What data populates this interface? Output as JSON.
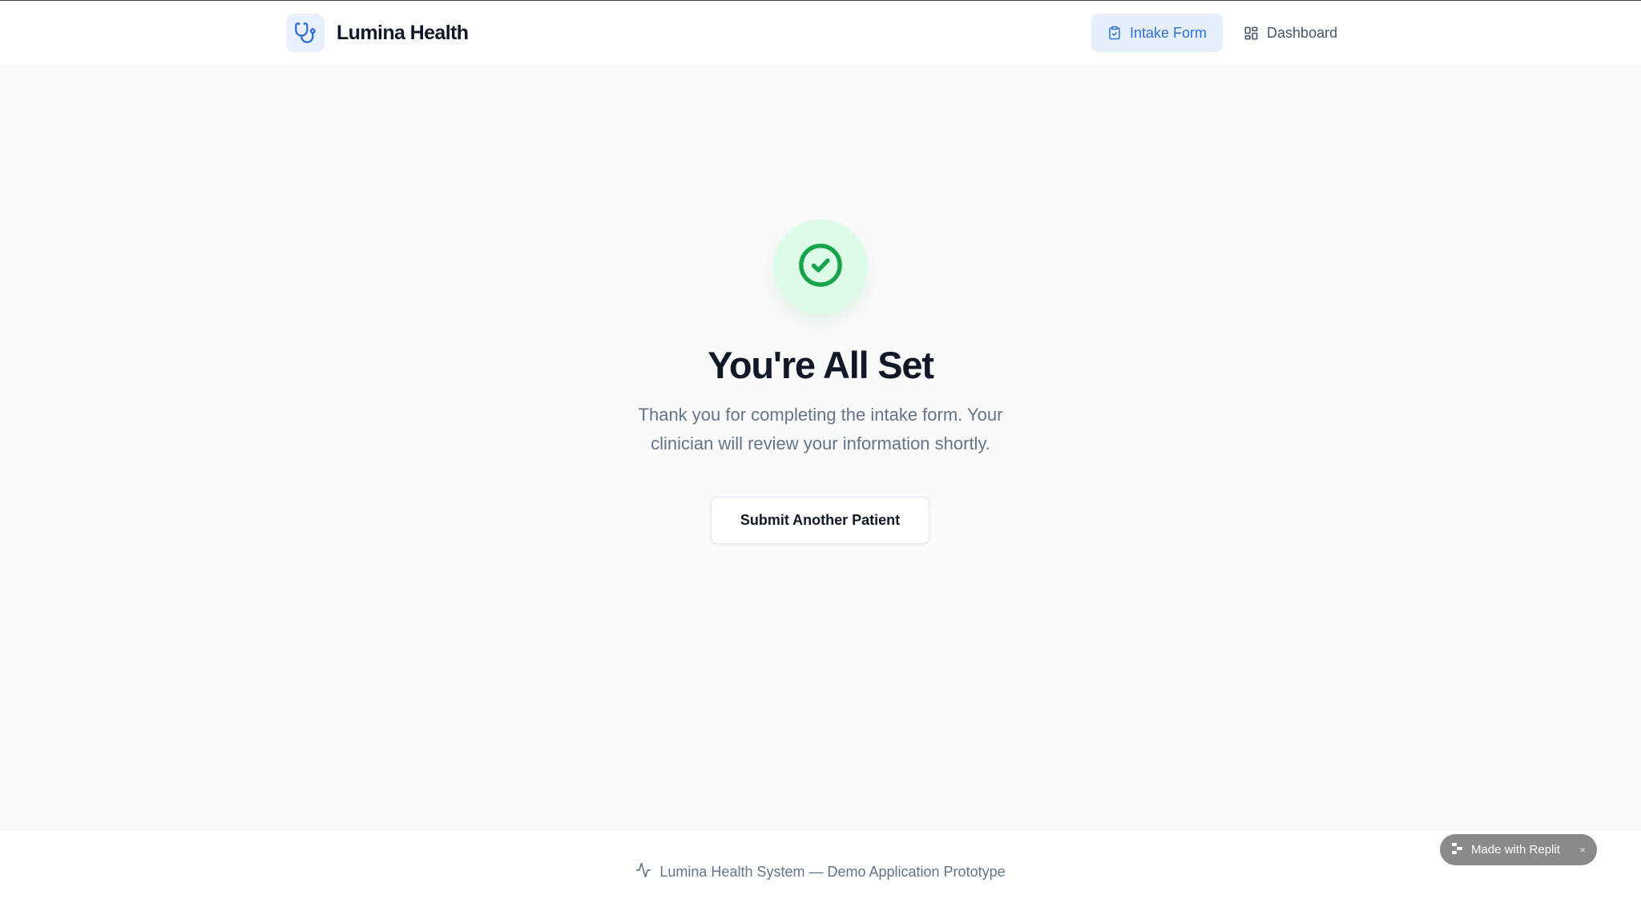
{
  "header": {
    "brand_name": "Lumina Health",
    "logo_icon": "stethoscope-icon",
    "nav": [
      {
        "label": "Intake Form",
        "icon": "clipboard-icon",
        "active": true
      },
      {
        "label": "Dashboard",
        "icon": "dashboard-grid-icon",
        "active": false
      }
    ]
  },
  "confirmation": {
    "icon": "check-circle-icon",
    "title": "You're All Set",
    "message": "Thank you for completing the intake form. Your clinician will review your information shortly.",
    "button_label": "Submit Another Patient"
  },
  "footer": {
    "icon": "activity-icon",
    "text": "Lumina Health System — Demo Application Prototype"
  },
  "badge": {
    "label": "Made with Replit",
    "close": "×"
  },
  "colors": {
    "accent": "#2f6fd6",
    "accent_bg": "#e6effc",
    "success": "#16a34a",
    "success_bg": "#dcfce7",
    "heading": "#111827",
    "muted": "#64748b"
  }
}
